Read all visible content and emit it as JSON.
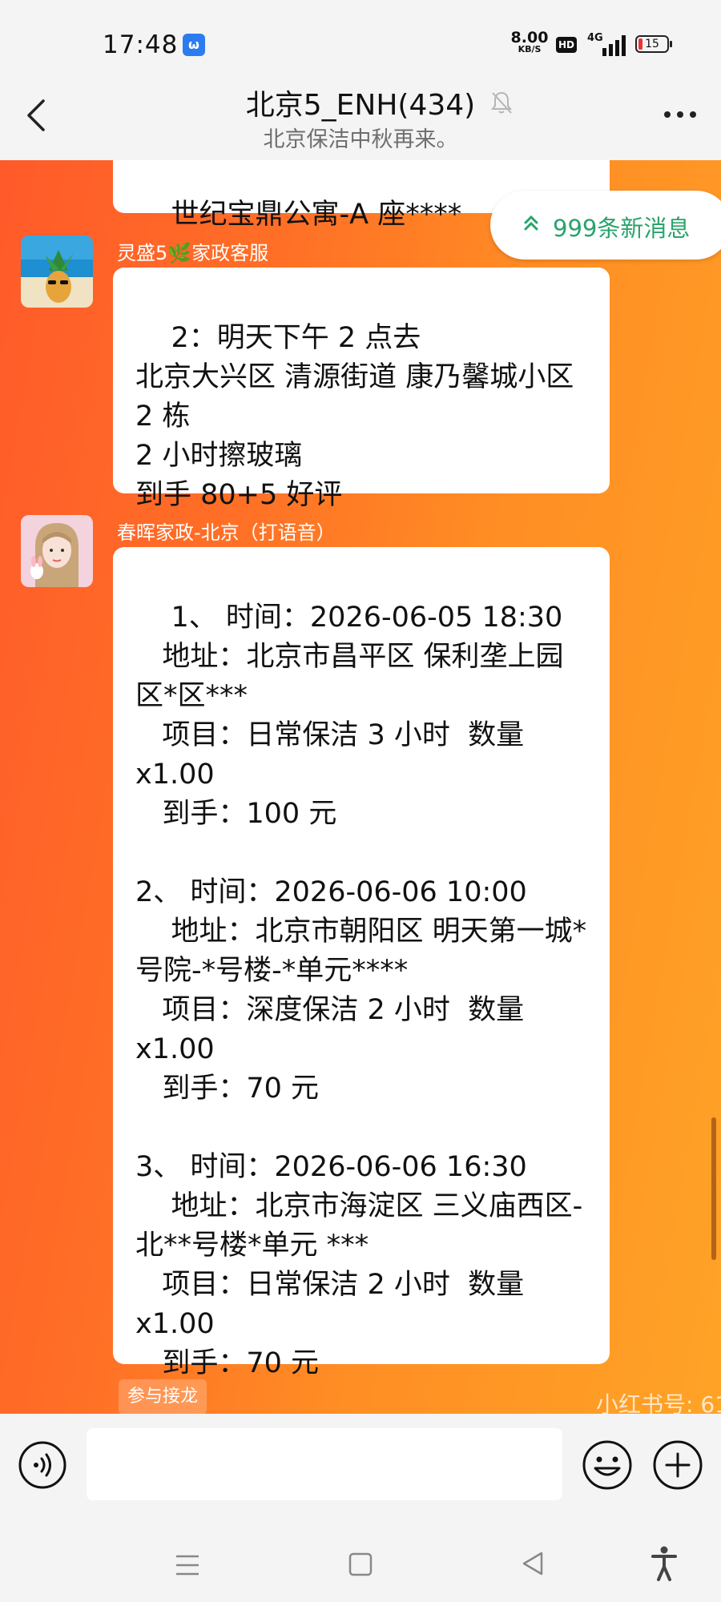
{
  "status_bar": {
    "time": "17:48",
    "app_icon_letter": "ω",
    "net_speed": "8.00",
    "net_unit": "KB/S",
    "hd": "HD",
    "network": "4G",
    "battery": "15",
    "battery_level_percent": 15
  },
  "header": {
    "title": "北京5_ENH(434)",
    "subtitle": "北京保洁中秋再来。",
    "icons": [
      "back-icon",
      "mute-bell-icon",
      "more-icon"
    ]
  },
  "new_messages": {
    "label": "999条新消息",
    "icon": "double-chevron-up-icon"
  },
  "messages": [
    {
      "sender": "",
      "text": "世纪宝鼎公寓-A 座****"
    },
    {
      "sender": "灵盛5🌿家政客服",
      "avatar": "pineapple-beach-avatar",
      "text": "2：明天下午 2 点去\n北京大兴区 清源街道 康乃馨城小区 2 栋\n2 小时擦玻璃\n到手 80+5 好评"
    },
    {
      "sender": "春晖家政-北京（打语音）",
      "avatar": "girl-portrait-avatar",
      "text": "1、 时间：2026-06-05 18:30\n   地址：北京市昌平区 保利垄上园区*区***\n   项目：日常保洁 3 小时  数量 x1.00\n   到手：100 元\n\n2、 时间：2026-06-06 10:00\n    地址：北京市朝阳区 明天第一城*号院-*号楼-*单元****\n   项目：深度保洁 2 小时  数量 x1.00\n   到手：70 元\n\n3、 时间：2026-06-06 16:30\n    地址：北京市海淀区 三义庙西区-北**号楼*单元 ***\n   项目：日常保洁 2 小时  数量 x1.00\n   到手：70 元"
    }
  ],
  "jielong_label": "参与接龙",
  "watermark": "小红书号: 61",
  "input": {
    "placeholder": "",
    "value": ""
  },
  "colors": {
    "chat_bg_left": "#ff5a2a",
    "chat_bg_right": "#ffa326",
    "new_msg_green": "#2aa36b",
    "battery_red": "#e33"
  }
}
